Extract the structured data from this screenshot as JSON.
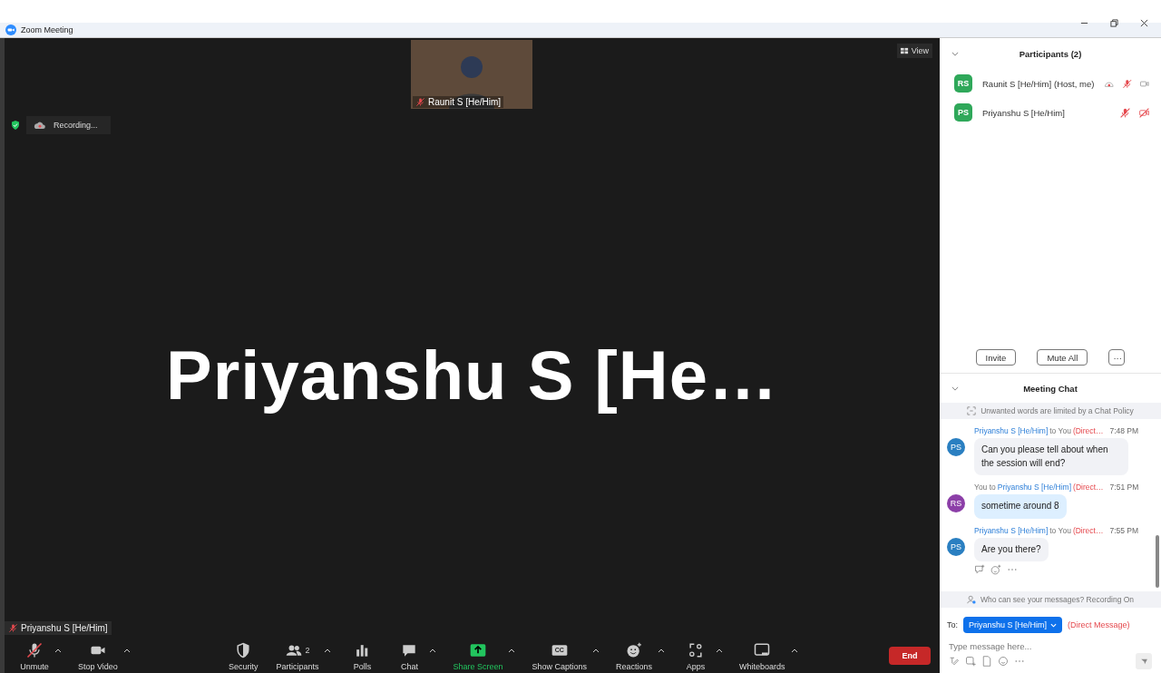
{
  "window": {
    "title": "Zoom Meeting"
  },
  "stage": {
    "view_button": "View",
    "recording_label": "Recording...",
    "speaker_name": "Priyanshu S [He…",
    "self_label": "Priyanshu S [He/Him]",
    "self_muted": true
  },
  "thumbnail": {
    "name": "Raunit S [He/Him]",
    "muted": true
  },
  "toolbar": [
    {
      "label": "Unmute",
      "muted": true,
      "menu": true
    },
    {
      "label": "Stop Video",
      "menu": true
    },
    {
      "label": "Security",
      "menu": false
    },
    {
      "label": "Participants",
      "count": "2",
      "menu": true
    },
    {
      "label": "Polls",
      "menu": false
    },
    {
      "label": "Chat",
      "menu": true
    },
    {
      "label": "Share Screen",
      "menu": true,
      "accent": true
    },
    {
      "label": "Show Captions",
      "glyph": "CC",
      "menu": true
    },
    {
      "label": "Reactions",
      "menu": true
    },
    {
      "label": "Apps",
      "menu": true
    },
    {
      "label": "Whiteboards",
      "menu": true
    }
  ],
  "end_button": "End",
  "participants": {
    "title": "Participants (2)",
    "items": [
      {
        "initials": "RS",
        "name": "Raunit S [He/Him]",
        "role": "(Host, me)",
        "color": "#2fa85a",
        "recording": true,
        "mic_muted": true,
        "video_on": true
      },
      {
        "initials": "PS",
        "name": "Priyanshu S [He/Him]",
        "color": "#2fa85a",
        "recording": false,
        "mic_muted": true,
        "video_on": false
      }
    ],
    "buttons": [
      "Invite",
      "Mute All",
      "···"
    ]
  },
  "chat": {
    "title": "Meeting Chat",
    "policy": "Unwanted words are limited by a Chat Policy",
    "messages": [
      {
        "avatar": "PS",
        "color": "#2a7fc1",
        "header": [
          {
            "text": "Priyanshu S [He/Him]",
            "link": true
          },
          {
            "text": "to You",
            "link": false
          }
        ],
        "direct": "(Direct…",
        "time": "7:48 PM",
        "text": "Can you please tell about when the session will end?",
        "mine": false
      },
      {
        "avatar": "RS",
        "color": "#8c3fa8",
        "header": [
          {
            "text": "You to",
            "link": false
          },
          {
            "text": "Priyanshu S [He/Him]",
            "link": true
          }
        ],
        "direct": "(Direct…",
        "time": "7:51 PM",
        "text": "sometime around 8",
        "mine": true
      },
      {
        "avatar": "PS",
        "color": "#2a7fc1",
        "header": [
          {
            "text": "Priyanshu S [He/Him]",
            "link": true
          },
          {
            "text": "to You",
            "link": false
          }
        ],
        "direct": "(Direct…",
        "time": "7:55 PM",
        "text": "Are you there?",
        "mine": false
      }
    ],
    "visibility_note": "Who can see your messages? Recording On",
    "to_label": "To:",
    "recipient": "Priyanshu S [He/Him]",
    "direct_label": "(Direct Message)",
    "input_placeholder": "Type message here..."
  }
}
